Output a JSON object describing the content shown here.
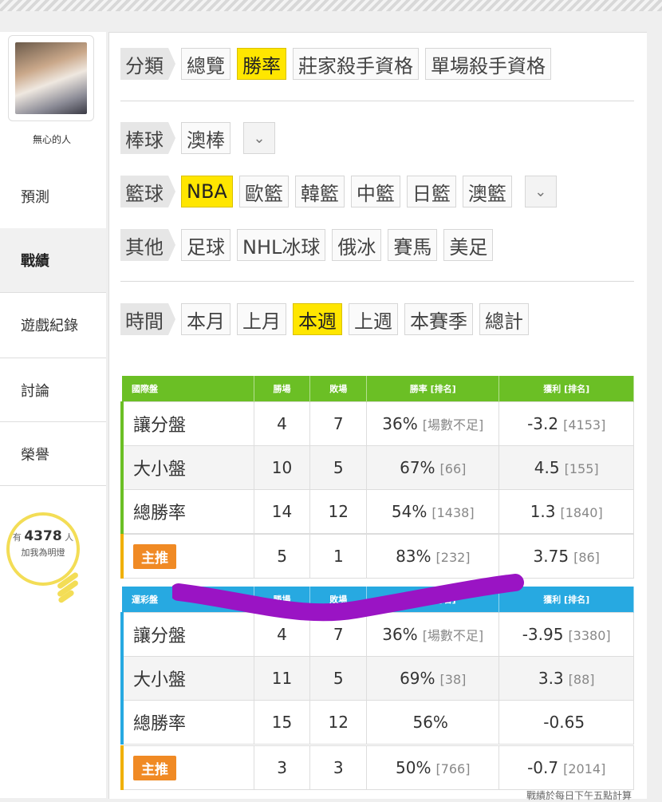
{
  "sidebar": {
    "username": "無心的人",
    "nav": [
      "預測",
      "戰績",
      "遊戲紀錄",
      "討論",
      "榮譽"
    ],
    "fans": {
      "prefix": "有",
      "count": "4378",
      "suffix": "人",
      "cta": "加我為明燈"
    }
  },
  "filters": {
    "category": {
      "label": "分類",
      "options": [
        "總覽",
        "勝率",
        "莊家殺手資格",
        "單場殺手資格"
      ],
      "selected": "勝率"
    },
    "baseball": {
      "label": "棒球",
      "options": [
        "澳棒"
      ]
    },
    "basketball": {
      "label": "籃球",
      "options": [
        "NBA",
        "歐籃",
        "韓籃",
        "中籃",
        "日籃",
        "澳籃"
      ],
      "selected": "NBA"
    },
    "other": {
      "label": "其他",
      "options": [
        "足球",
        "NHL冰球",
        "俄冰",
        "賽馬",
        "美足"
      ]
    },
    "time": {
      "label": "時間",
      "options": [
        "本月",
        "上月",
        "本週",
        "上週",
        "本賽季",
        "總計"
      ],
      "selected": "本週"
    }
  },
  "intl_table": {
    "title": "國際盤",
    "headers": [
      "勝場",
      "敗場",
      "勝率 [排名]",
      "獲利 [排名]"
    ],
    "rows": [
      {
        "label": "讓分盤",
        "win": "4",
        "loss": "7",
        "rate": "36%",
        "rate_rank": "[場數不足]",
        "profit": "-3.2",
        "profit_rank": "[4153]"
      },
      {
        "label": "大小盤",
        "win": "10",
        "loss": "5",
        "rate": "67%",
        "rate_rank": "[66]",
        "profit": "4.5",
        "profit_rank": "[155]"
      },
      {
        "label": "總勝率",
        "win": "14",
        "loss": "12",
        "rate": "54%",
        "rate_rank": "[1438]",
        "profit": "1.3",
        "profit_rank": "[1840]"
      }
    ],
    "main": {
      "label": "主推",
      "win": "5",
      "loss": "1",
      "rate": "83%",
      "rate_rank": "[232]",
      "profit": "3.75",
      "profit_rank": "[86]"
    }
  },
  "lottery_table": {
    "title": "運彩盤",
    "headers": [
      "勝場",
      "敗場",
      "勝率 [排名]",
      "獲利 [排名]"
    ],
    "rows": [
      {
        "label": "讓分盤",
        "win": "4",
        "loss": "7",
        "rate": "36%",
        "rate_rank": "[場數不足]",
        "profit": "-3.95",
        "profit_rank": "[3380]"
      },
      {
        "label": "大小盤",
        "win": "11",
        "loss": "5",
        "rate": "69%",
        "rate_rank": "[38]",
        "profit": "3.3",
        "profit_rank": "[88]"
      },
      {
        "label": "總勝率",
        "win": "15",
        "loss": "12",
        "rate": "56%",
        "rate_rank": "",
        "profit": "-0.65",
        "profit_rank": ""
      }
    ],
    "main": {
      "label": "主推",
      "win": "3",
      "loss": "3",
      "rate": "50%",
      "rate_rank": "[766]",
      "profit": "-0.7",
      "profit_rank": "[2014]"
    }
  },
  "footer_note": "戰績於每日下午五點計算",
  "colors": {
    "selected": "#ffe600",
    "intl_header": "#6bbf25",
    "lottery_header": "#27a9e1",
    "badge": "#f08a24",
    "scribble": "#9a14c4"
  }
}
